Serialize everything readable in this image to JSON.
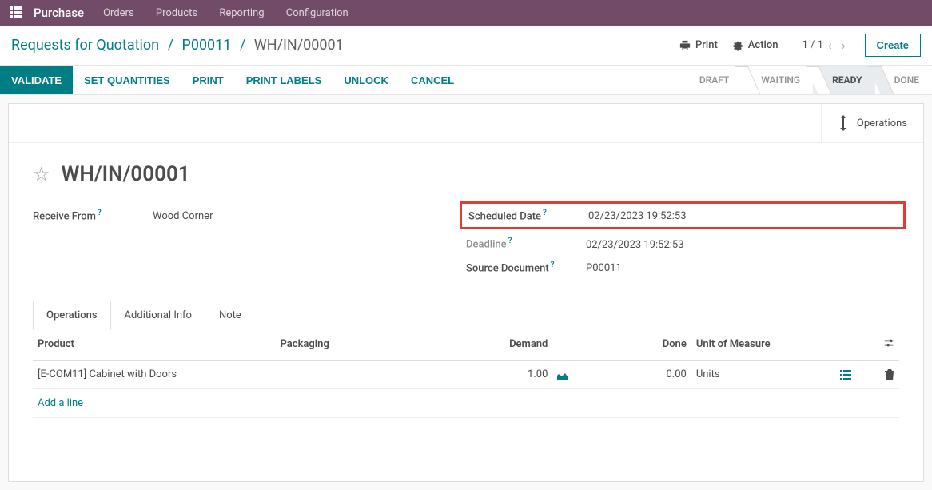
{
  "top": {
    "brand": "Purchase",
    "menu": [
      "Orders",
      "Products",
      "Reporting",
      "Configuration"
    ]
  },
  "breadcrumb": {
    "items": [
      "Requests for Quotation",
      "P00011",
      "WH/IN/00001"
    ]
  },
  "controls": {
    "print": "Print",
    "action": "Action",
    "pager": "1 / 1",
    "create": "Create"
  },
  "actions": {
    "validate": "VALIDATE",
    "set_quantities": "SET QUANTITIES",
    "print": "PRINT",
    "print_labels": "PRINT LABELS",
    "unlock": "UNLOCK",
    "cancel": "CANCEL"
  },
  "status_stages": [
    "DRAFT",
    "WAITING",
    "READY",
    "DONE"
  ],
  "status_active_index": 2,
  "sheet": {
    "operations_btn": "Operations",
    "title": "WH/IN/00001",
    "left": {
      "receive_from_label": "Receive From",
      "receive_from_value": "Wood Corner"
    },
    "right": {
      "scheduled_date_label": "Scheduled Date",
      "scheduled_date_value": "02/23/2023 19:52:53",
      "deadline_label": "Deadline",
      "deadline_value": "02/23/2023 19:52:53",
      "source_doc_label": "Source Document",
      "source_doc_value": "P00011"
    }
  },
  "tabs": [
    "Operations",
    "Additional Info",
    "Note"
  ],
  "tab_active_index": 0,
  "table": {
    "headers": {
      "product": "Product",
      "packaging": "Packaging",
      "demand": "Demand",
      "done": "Done",
      "uom": "Unit of Measure"
    },
    "rows": [
      {
        "product": "[E-COM11] Cabinet with Doors",
        "packaging": "",
        "demand": "1.00",
        "done": "0.00",
        "uom": "Units"
      }
    ],
    "add_line": "Add a line"
  }
}
